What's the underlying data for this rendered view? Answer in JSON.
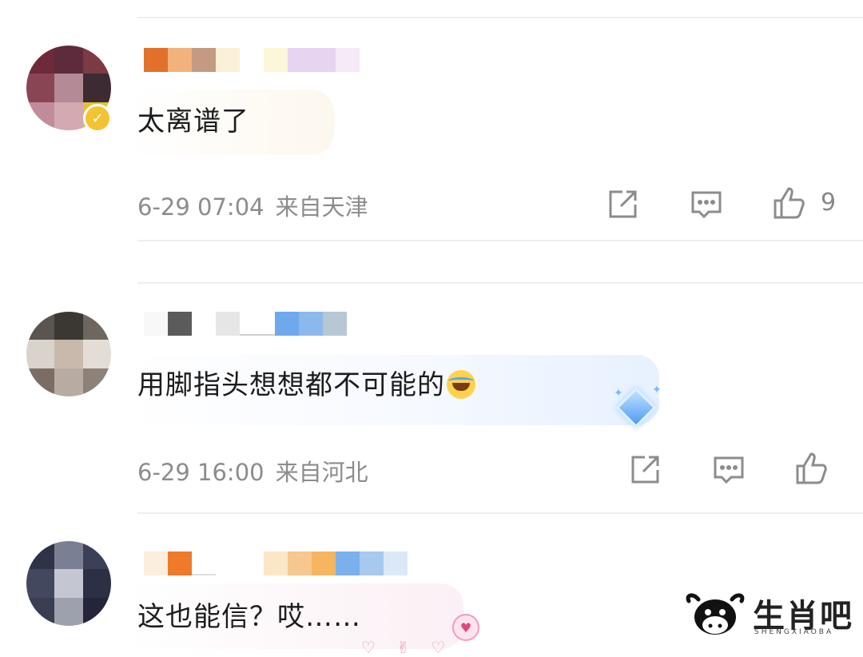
{
  "comments": [
    {
      "text": "太离谱了",
      "date": "6-29 07:04",
      "location": "来自天津",
      "like_count": "9"
    },
    {
      "text": "用脚指头想想都不可能的",
      "date": "6-29 16:00",
      "location": "来自河北",
      "like_count": ""
    },
    {
      "text": "这也能信？哎……"
    }
  ],
  "icons": {
    "share": "share-icon",
    "reply": "comment-icon",
    "like": "thumbs-up-icon",
    "emoji": "laughing-tears-emoji",
    "verified": "verified-badge-icon"
  },
  "watermark": {
    "brand": "生肖吧",
    "subtitle": "SHENGXIAOBA"
  },
  "colors": {
    "meta_text": "#8c8c8c",
    "separator": "#eeeeee",
    "verified_badge": "#f3c331"
  }
}
